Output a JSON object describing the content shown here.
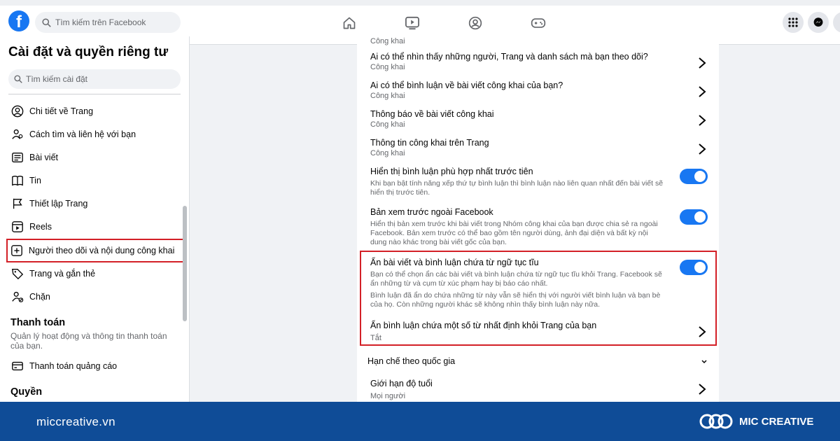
{
  "topbar": {
    "logo_letter": "f",
    "search_placeholder": "Tìm kiếm trên Facebook"
  },
  "sidebar": {
    "title": "Cài đặt và quyền riêng tư",
    "search_placeholder": "Tìm kiếm cài đặt",
    "items": [
      {
        "label": "Chi tiết về Trang",
        "icon": "user-circle-icon"
      },
      {
        "label": "Cách tìm và liên hệ với bạn",
        "icon": "people-icon"
      },
      {
        "label": "Bài viết",
        "icon": "post-icon"
      },
      {
        "label": "Tin",
        "icon": "book-icon"
      },
      {
        "label": "Thiết lập Trang",
        "icon": "flag-icon"
      },
      {
        "label": "Reels",
        "icon": "reels-icon"
      },
      {
        "label": "Người theo dõi và nội dung công khai",
        "icon": "plus-square-icon"
      },
      {
        "label": "Trang và gắn thẻ",
        "icon": "tag-icon"
      },
      {
        "label": "Chặn",
        "icon": "block-user-icon"
      }
    ],
    "payment": {
      "title": "Thanh toán",
      "subtitle": "Quản lý hoạt động và thông tin thanh toán của bạn.",
      "item": "Thanh toán quảng cáo"
    },
    "permissions_title": "Quyền"
  },
  "main": {
    "top_cut_sub": "Công khai",
    "rows": [
      {
        "title": "Ai có thể nhìn thấy những người, Trang và danh sách mà bạn theo dõi?",
        "sub": "Công khai"
      },
      {
        "title": "Ai có thể bình luận về bài viết công khai của bạn?",
        "sub": "Công khai"
      },
      {
        "title": "Thông báo về bài viết công khai",
        "sub": "Công khai"
      },
      {
        "title": "Thông tin công khai trên Trang",
        "sub": "Công khai"
      }
    ],
    "toggles": [
      {
        "title": "Hiển thị bình luận phù hợp nhất trước tiên",
        "desc": "Khi bạn bật tính năng xếp thứ tự bình luận thì bình luận nào liên quan nhất đến bài viết sẽ hiển thị trước tiên.",
        "on": true
      },
      {
        "title": "Bản xem trước ngoài Facebook",
        "desc": "Hiển thị bản xem trước khi bài viết trong Nhóm công khai của bạn được chia sẻ ra ngoài Facebook. Bản xem trước có thể bao gồm tên người dùng, ảnh đại diện và bất kỳ nội dung nào khác trong bài viết gốc của bạn.",
        "on": true
      },
      {
        "title": "Ẩn bài viết và bình luận chứa từ ngữ tục tĩu",
        "desc": "Bạn có thể chọn ẩn các bài viết và bình luận chứa từ ngữ tục tĩu khỏi Trang. Facebook sẽ ẩn những từ và cụm từ xúc phạm hay bị báo cáo nhất.",
        "desc2": "Bình luận đã ẩn do chứa những từ này vẫn sẽ hiển thị với người viết bình luận và bạn bè của họ. Còn những người khác sẽ không nhìn thấy bình luận này nữa.",
        "on": true
      }
    ],
    "hide_comments": {
      "title": "Ẩn bình luận chứa một số từ nhất định khỏi Trang của bạn",
      "sub": "Tắt"
    },
    "country_section": "Hạn chế theo quốc gia",
    "age_limit": {
      "title": "Giới hạn độ tuổi",
      "sub": "Mọi người"
    }
  },
  "footer": {
    "url": "miccreative.vn",
    "brand": "MIC CREATIVE"
  },
  "colors": {
    "facebook_blue": "#1877f2",
    "highlight_red": "#d32027",
    "footer_blue": "#0f4c97"
  }
}
